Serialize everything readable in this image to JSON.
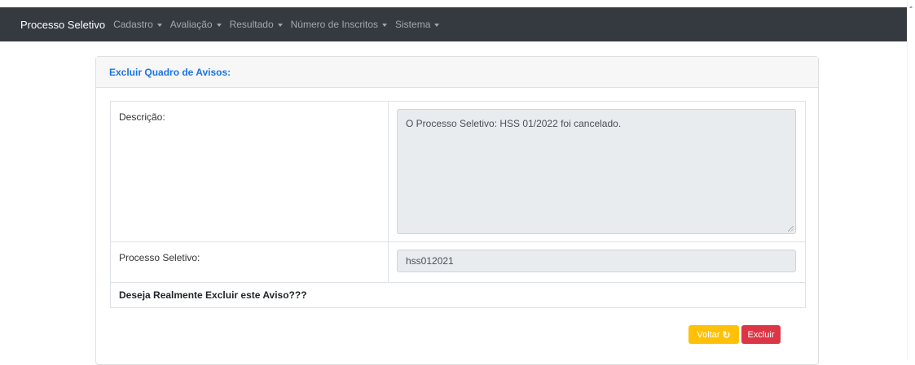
{
  "navbar": {
    "brand": "Processo Seletivo",
    "items": [
      {
        "label": "Cadastro"
      },
      {
        "label": "Avaliação"
      },
      {
        "label": "Resultado"
      },
      {
        "label": "Número de Inscritos"
      },
      {
        "label": "Sistema"
      }
    ]
  },
  "card": {
    "title": "Excluir Quadro de Avisos:"
  },
  "form": {
    "descricao_label": "Descrição:",
    "descricao_value": "O Processo Seletivo: HSS 01/2022 foi cancelado.",
    "processo_label": "Processo Seletivo:",
    "processo_value": "hss012021",
    "confirm_text": "Deseja Realmente Excluir este Aviso???"
  },
  "buttons": {
    "back_label": "Voltar",
    "back_icon": "refresh-icon",
    "delete_label": "Excluir"
  },
  "colors": {
    "navbar": "#343a40",
    "title": "#1a73e8",
    "back_button": "#ffc107",
    "delete_button": "#dc3545"
  }
}
